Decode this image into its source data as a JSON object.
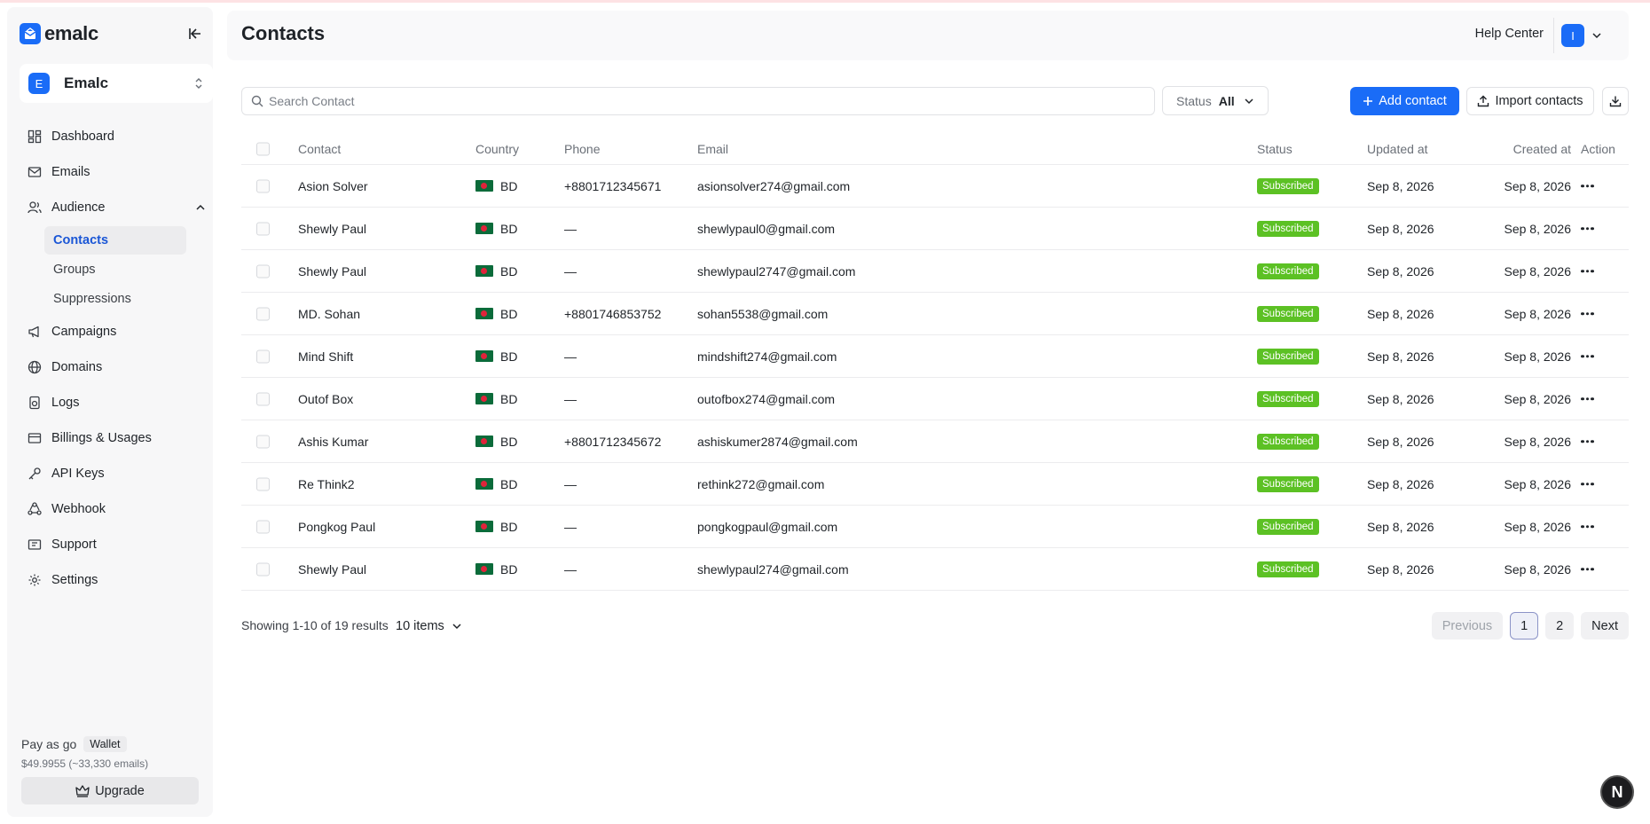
{
  "brand": {
    "name": "emalc"
  },
  "workspace": {
    "initial": "E",
    "name": "Emalc"
  },
  "nav": {
    "dashboard": "Dashboard",
    "emails": "Emails",
    "audience": "Audience",
    "audience_sub": {
      "contacts": "Contacts",
      "groups": "Groups",
      "suppressions": "Suppressions"
    },
    "campaigns": "Campaigns",
    "domains": "Domains",
    "logs": "Logs",
    "billings": "Billings & Usages",
    "api_keys": "API Keys",
    "webhook": "Webhook",
    "support": "Support",
    "settings": "Settings"
  },
  "wallet": {
    "plan": "Pay as go",
    "tag": "Wallet",
    "balance": "$49.9955 (~33,330 emails)",
    "upgrade_label": "Upgrade"
  },
  "header": {
    "title": "Contacts",
    "help": "Help Center",
    "user_initial": "I"
  },
  "toolbar": {
    "search_placeholder": "Search Contact",
    "status_label": "Status",
    "status_value": "All",
    "add_label": "Add contact",
    "import_label": "Import contacts"
  },
  "table": {
    "columns": {
      "contact": "Contact",
      "country": "Country",
      "phone": "Phone",
      "email": "Email",
      "status": "Status",
      "updated": "Updated at",
      "created": "Created at",
      "action": "Action"
    },
    "rows": [
      {
        "name": "Asion Solver",
        "country": "BD",
        "phone": "+8801712345671",
        "email": "asionsolver274@gmail.com",
        "status": "Subscribed",
        "updated": "Sep 8, 2026",
        "created": "Sep 8, 2026"
      },
      {
        "name": "Shewly Paul",
        "country": "BD",
        "phone": "—",
        "email": "shewlypaul0@gmail.com",
        "status": "Subscribed",
        "updated": "Sep 8, 2026",
        "created": "Sep 8, 2026"
      },
      {
        "name": "Shewly Paul",
        "country": "BD",
        "phone": "—",
        "email": "shewlypaul2747@gmail.com",
        "status": "Subscribed",
        "updated": "Sep 8, 2026",
        "created": "Sep 8, 2026"
      },
      {
        "name": "MD. Sohan",
        "country": "BD",
        "phone": "+8801746853752",
        "email": "sohan5538@gmail.com",
        "status": "Subscribed",
        "updated": "Sep 8, 2026",
        "created": "Sep 8, 2026"
      },
      {
        "name": "Mind Shift",
        "country": "BD",
        "phone": "—",
        "email": "mindshift274@gmail.com",
        "status": "Subscribed",
        "updated": "Sep 8, 2026",
        "created": "Sep 8, 2026"
      },
      {
        "name": "Outof Box",
        "country": "BD",
        "phone": "—",
        "email": "outofbox274@gmail.com",
        "status": "Subscribed",
        "updated": "Sep 8, 2026",
        "created": "Sep 8, 2026"
      },
      {
        "name": "Ashis Kumar",
        "country": "BD",
        "phone": "+8801712345672",
        "email": "ashiskumer2874@gmail.com",
        "status": "Subscribed",
        "updated": "Sep 8, 2026",
        "created": "Sep 8, 2026"
      },
      {
        "name": "Re Think2",
        "country": "BD",
        "phone": "—",
        "email": "rethink272@gmail.com",
        "status": "Subscribed",
        "updated": "Sep 8, 2026",
        "created": "Sep 8, 2026"
      },
      {
        "name": "Pongkog Paul",
        "country": "BD",
        "phone": "—",
        "email": "pongkogpaul@gmail.com",
        "status": "Subscribed",
        "updated": "Sep 8, 2026",
        "created": "Sep 8, 2026"
      },
      {
        "name": "Shewly Paul",
        "country": "BD",
        "phone": "—",
        "email": "shewlypaul274@gmail.com",
        "status": "Subscribed",
        "updated": "Sep 8, 2026",
        "created": "Sep 8, 2026"
      }
    ]
  },
  "footer": {
    "results": "Showing 1-10 of 19 results",
    "per_page": "10 items",
    "previous": "Previous",
    "pages": [
      "1",
      "2"
    ],
    "next": "Next"
  },
  "dev_badge": "N",
  "colors": {
    "accent": "#1a6cf7",
    "subscribed": "#5cc124"
  },
  "icons": {
    "nav": [
      "dashboard-icon",
      "mail-icon",
      "users-icon",
      "megaphone-icon",
      "globe-icon",
      "logs-icon",
      "credit-card-icon",
      "key-icon",
      "webhook-icon",
      "support-icon",
      "gear-icon"
    ],
    "toolbar": [
      "search-icon",
      "chevron-down-icon",
      "plus-icon",
      "upload-icon",
      "download-icon"
    ]
  }
}
